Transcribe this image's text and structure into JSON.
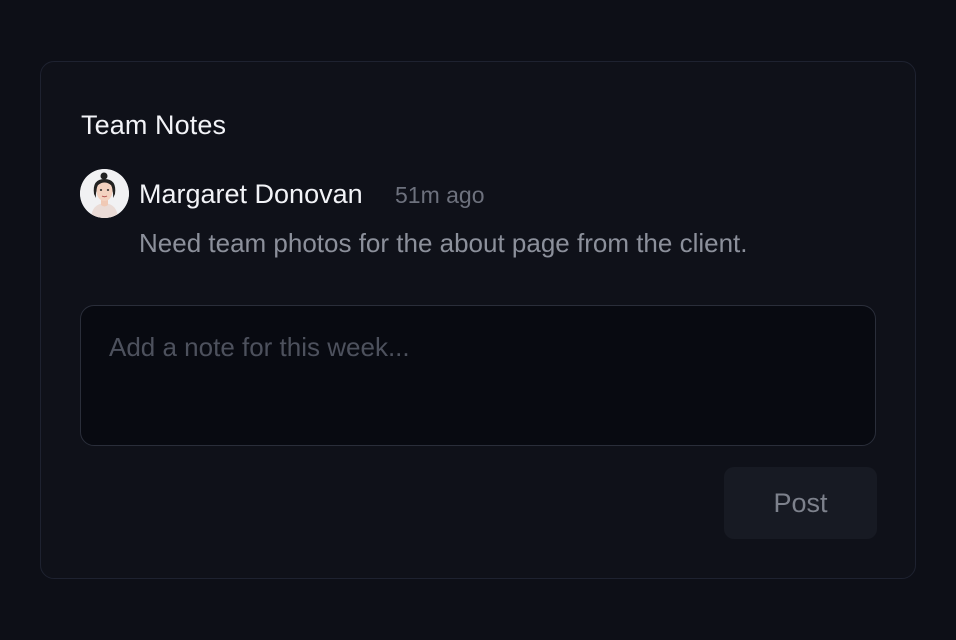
{
  "panel": {
    "title": "Team Notes"
  },
  "notes": [
    {
      "author": "Margaret Donovan",
      "time": "51m ago",
      "text": "Need team photos for the about page from the client."
    }
  ],
  "composer": {
    "placeholder": "Add a note for this week...",
    "value": "",
    "post_label": "Post"
  }
}
